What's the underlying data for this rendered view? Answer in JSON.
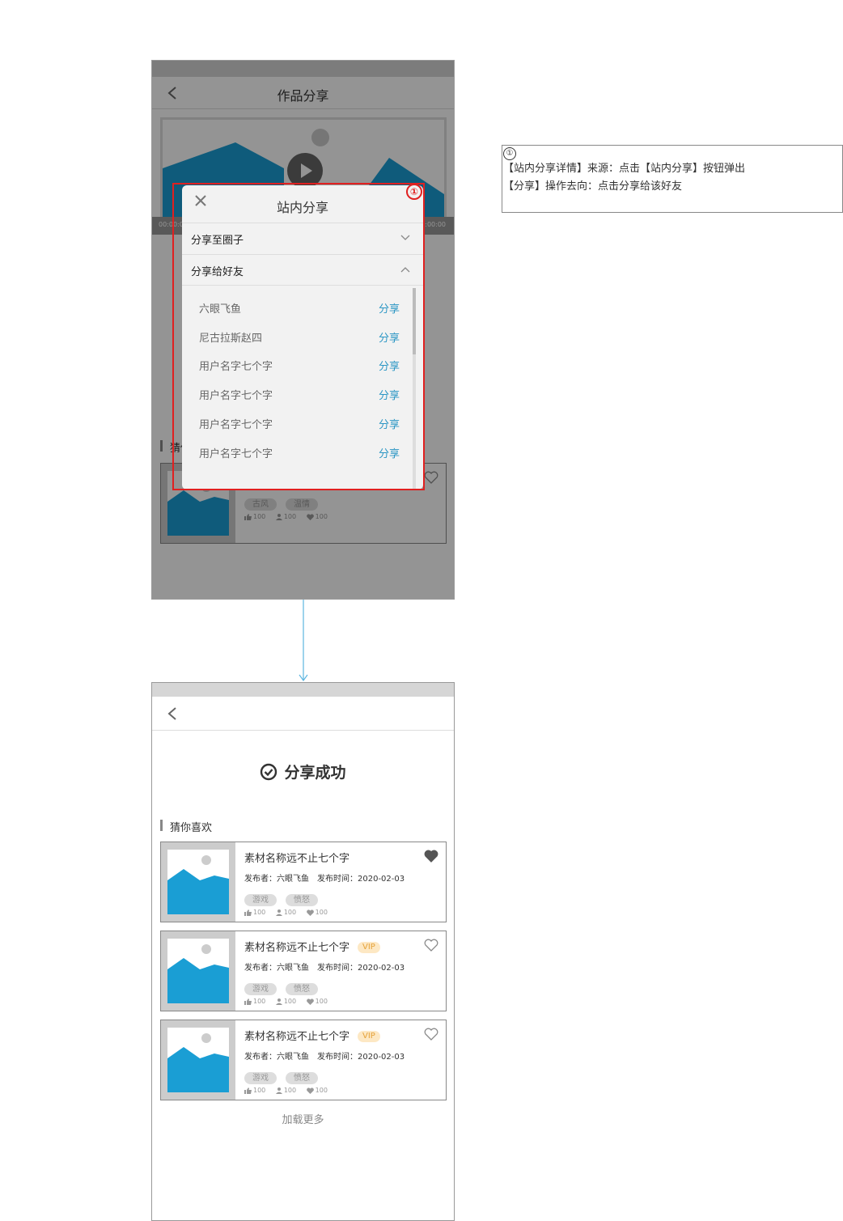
{
  "screen1": {
    "nav_title": "作品分享",
    "video_time_start": "00:00:00",
    "video_time_end": "00:00:00",
    "section_title": "猜你喜欢",
    "card": {
      "tags": [
        "古风",
        "温情"
      ],
      "likes": "100",
      "users": "100",
      "favs": "100"
    }
  },
  "modal": {
    "title": "站内分享",
    "accordion": [
      {
        "label": "分享至圈子",
        "state": "collapsed"
      },
      {
        "label": "分享给好友",
        "state": "expanded"
      }
    ],
    "friends": [
      {
        "name": "六眼飞鱼",
        "action": "分享"
      },
      {
        "name": "尼古拉斯赵四",
        "action": "分享"
      },
      {
        "name": "用户名字七个字",
        "action": "分享"
      },
      {
        "name": "用户名字七个字",
        "action": "分享"
      },
      {
        "name": "用户名字七个字",
        "action": "分享"
      },
      {
        "name": "用户名字七个字",
        "action": "分享"
      }
    ]
  },
  "annotation": {
    "marker": "①",
    "lines": [
      "【站内分享详情】来源：点击【站内分享】按钮弹出",
      "【分享】操作去向：点击分享给该好友"
    ]
  },
  "screen2": {
    "success_text": "分享成功",
    "section_title": "猜你喜欢",
    "cards": [
      {
        "title": "素材名称远不止七个字",
        "vip": "",
        "publisher": "发布者：六眼飞鱼",
        "time": "发布时间：2020-02-03",
        "tags": [
          "游戏",
          "愤怒"
        ],
        "likes": "100",
        "users": "100",
        "favs": "100",
        "favorited": true
      },
      {
        "title": "素材名称远不止七个字",
        "vip": "VIP",
        "publisher": "发布者：六眼飞鱼",
        "time": "发布时间：2020-02-03",
        "tags": [
          "游戏",
          "愤怒"
        ],
        "likes": "100",
        "users": "100",
        "favs": "100",
        "favorited": false
      },
      {
        "title": "素材名称远不止七个字",
        "vip": "VIP",
        "publisher": "发布者：六眼飞鱼",
        "time": "发布时间：2020-02-03",
        "tags": [
          "游戏",
          "愤怒"
        ],
        "likes": "100",
        "users": "100",
        "favs": "100",
        "favorited": false
      }
    ],
    "load_more": "加载更多"
  },
  "colors": {
    "accent_blue": "#2b96c4",
    "image_blue": "#1a9ed4",
    "annotation_red": "#e02020",
    "vip_text": "#e5a23a",
    "vip_bg": "#fde8c4"
  },
  "icons": [
    "back-arrow-icon",
    "play-icon",
    "close-icon",
    "chevron-down-icon",
    "chevron-up-icon",
    "check-circle-icon",
    "heart-icon",
    "thumb-up-icon",
    "user-icon",
    "image-placeholder-icon"
  ]
}
